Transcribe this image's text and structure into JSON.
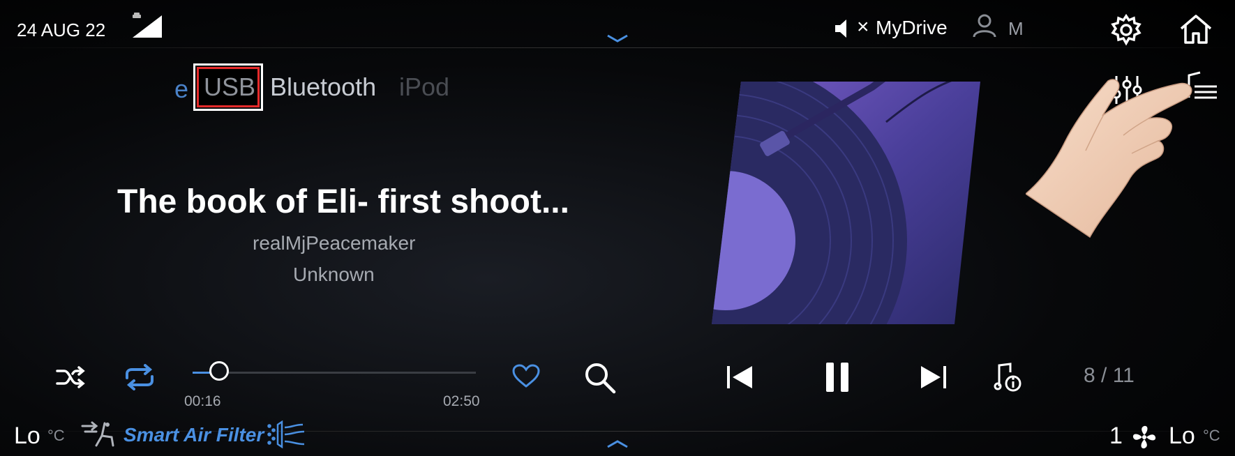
{
  "status_bar": {
    "date": "24 AUG 22",
    "profile_name": "MyDrive",
    "user_initial": "M",
    "mute_x": "×"
  },
  "sources": {
    "items": [
      {
        "label": "e",
        "state": "partial"
      },
      {
        "label": "USB",
        "state": "selected"
      },
      {
        "label": "Bluetooth",
        "state": "normal"
      },
      {
        "label": "iPod",
        "state": "faded"
      }
    ]
  },
  "now_playing": {
    "title": "The book of Eli- first shoot...",
    "artist": "realMjPeacemaker",
    "album": "Unknown"
  },
  "playback": {
    "elapsed": "00:16",
    "total": "02:50",
    "progress_fraction": 0.094,
    "track_position": "8 / 11"
  },
  "climate": {
    "left_temp": "Lo",
    "left_unit": "°C",
    "smart_air_filter": "Smart Air Filter",
    "fan_level": "1",
    "right_temp": "Lo",
    "right_unit": "°C"
  },
  "colors": {
    "accent": "#4a90e2",
    "highlight_box": "#e52b2b",
    "background": "#000000"
  },
  "icons": [
    "signal-icon",
    "car-icon",
    "mute-icon",
    "user-icon",
    "gear-icon",
    "home-icon",
    "equalizer-icon",
    "playlist-icon",
    "shuffle-icon",
    "repeat-icon",
    "heart-icon",
    "search-icon",
    "previous-icon",
    "pause-icon",
    "next-icon",
    "music-info-icon",
    "seat-airflow-icon",
    "air-filter-icon",
    "fan-icon",
    "chevron-down-icon",
    "chevron-up-icon"
  ]
}
